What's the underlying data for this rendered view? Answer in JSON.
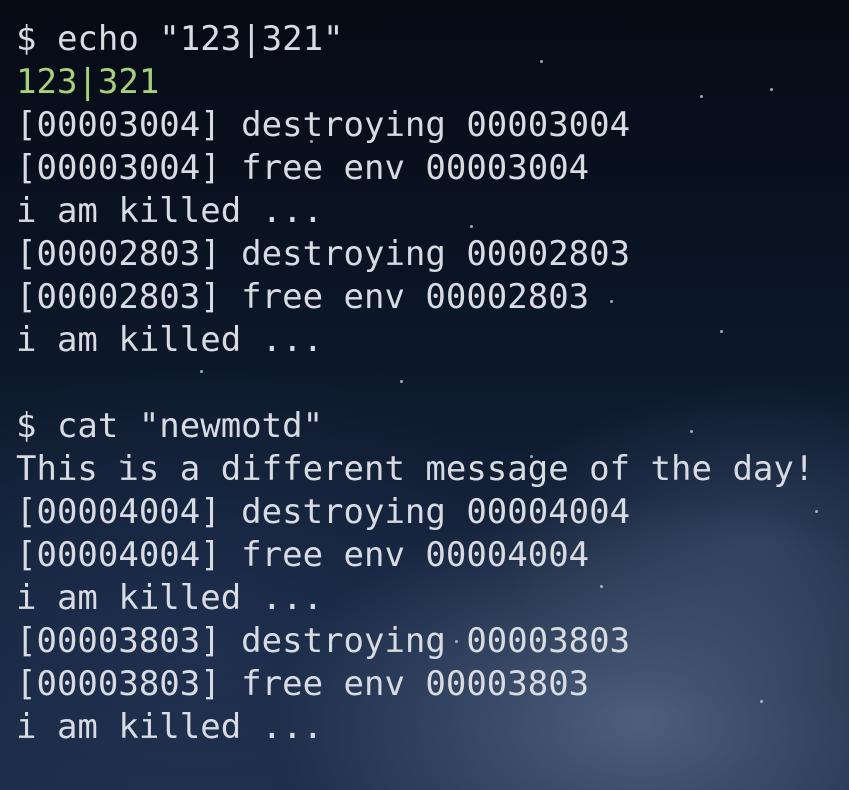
{
  "colors": {
    "text": "#d8dbe2",
    "output_green": "#a8d07a",
    "background": "#0a1424"
  },
  "lines": [
    {
      "text": "$ echo \"123|321\"",
      "color": "default"
    },
    {
      "text": "123|321",
      "color": "green"
    },
    {
      "text": "[00003004] destroying 00003004",
      "color": "default"
    },
    {
      "text": "[00003004] free env 00003004",
      "color": "default"
    },
    {
      "text": "i am killed ...",
      "color": "default"
    },
    {
      "text": "[00002803] destroying 00002803",
      "color": "default"
    },
    {
      "text": "[00002803] free env 00002803",
      "color": "default"
    },
    {
      "text": "i am killed ...",
      "color": "default"
    },
    {
      "text": "",
      "color": "default"
    },
    {
      "text": "$ cat \"newmotd\"",
      "color": "default"
    },
    {
      "text": "This is a different message of the day!",
      "color": "default"
    },
    {
      "text": "[00004004] destroying 00004004",
      "color": "default"
    },
    {
      "text": "[00004004] free env 00004004",
      "color": "default"
    },
    {
      "text": "i am killed ...",
      "color": "default"
    },
    {
      "text": "[00003803] destroying 00003803",
      "color": "default"
    },
    {
      "text": "[00003803] free env 00003803",
      "color": "default"
    },
    {
      "text": "i am killed ...",
      "color": "default"
    }
  ]
}
